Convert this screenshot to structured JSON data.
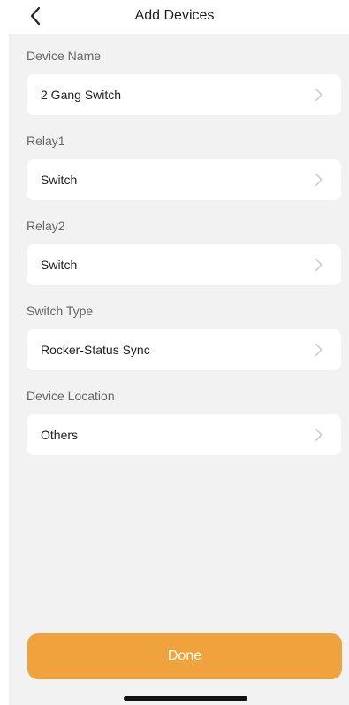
{
  "header": {
    "title": "Add Devices",
    "back_icon": "chevron-left-icon"
  },
  "fields": [
    {
      "label": "Device Name",
      "value": "2 Gang Switch"
    },
    {
      "label": "Relay1",
      "value": "Switch"
    },
    {
      "label": "Relay2",
      "value": "Switch"
    },
    {
      "label": "Switch Type",
      "value": "Rocker-Status Sync"
    },
    {
      "label": "Device Location",
      "value": "Others"
    }
  ],
  "done_button": {
    "label": "Done"
  },
  "colors": {
    "accent": "#f0a33c",
    "background": "#f2f2f2",
    "card": "#ffffff",
    "label_text": "#666666",
    "value_text": "#222222",
    "chevron": "#cfcfcf"
  }
}
